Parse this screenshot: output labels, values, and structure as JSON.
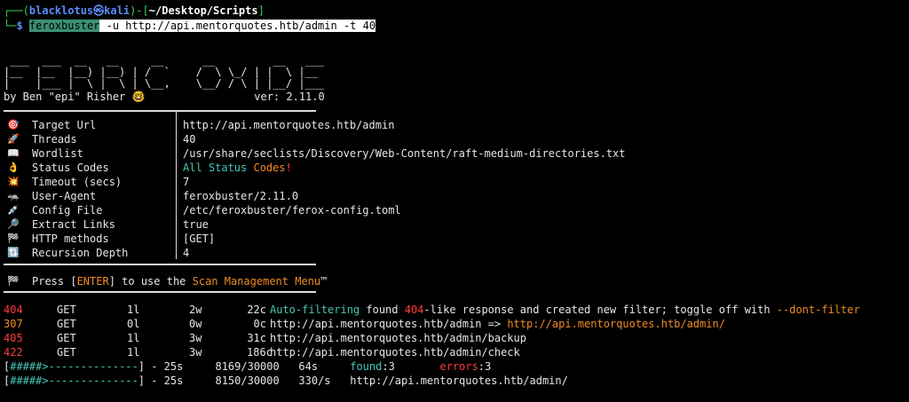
{
  "prompt": {
    "corner_top": "┌──(",
    "user": "blacklotus",
    "at": "㉿",
    "host": "kali",
    "close": ")-[",
    "path": "~/Desktop/Scripts",
    "close2": "]",
    "corner_bottom": "└─",
    "dollar": "$",
    "command_name": "feroxbuster",
    "command_args": " -u http://api.mentorquotes.htb/admin -t 40"
  },
  "banner": {
    "ascii": [
      " ___  ___  __   __     __      __         __   ___",
      "|__  |__  |__) |__) | /  `    /  \\ \\_/ | |  \\ |__",
      "|    |___ |  \\ |  \\ | \\__,    \\__/ / \\ | |__/ |___"
    ],
    "byline": "by Ben \"epi\" Risher 🤓                 ver: 2.11.0"
  },
  "config": [
    {
      "icon": "🎯",
      "icon_name": "target-icon",
      "label": "Target Url",
      "value": "http://api.mentorquotes.htb/admin"
    },
    {
      "icon": "🚀",
      "icon_name": "rocket-icon",
      "label": "Threads",
      "value": "40"
    },
    {
      "icon": "📖",
      "icon_name": "book-icon",
      "label": "Wordlist",
      "value": "/usr/share/seclists/Discovery/Web-Content/raft-medium-directories.txt"
    },
    {
      "icon": "👌",
      "icon_name": "ok-hand-icon",
      "label": "Status Codes",
      "value_a": "All Status ",
      "value_b": "Codes",
      "value_c": "!"
    },
    {
      "icon": "💥",
      "icon_name": "collision-icon",
      "label": "Timeout (secs)",
      "value": "7"
    },
    {
      "icon": "🦡",
      "icon_name": "badger-icon",
      "label": "User-Agent",
      "value": "feroxbuster/2.11.0"
    },
    {
      "icon": "💉",
      "icon_name": "syringe-icon",
      "label": "Config File",
      "value": "/etc/feroxbuster/ferox-config.toml"
    },
    {
      "icon": "🔎",
      "icon_name": "magnifier-icon",
      "label": "Extract Links",
      "value": "true"
    },
    {
      "icon": "🏁",
      "icon_name": "checkered-flag-icon",
      "label": "HTTP methods",
      "value": "[GET]"
    },
    {
      "icon": "🔃",
      "icon_name": "recursion-icon",
      "label": "Recursion Depth",
      "value": "4"
    }
  ],
  "press_enter": {
    "icon": "🏁",
    "text_a": "Press [",
    "enter": "ENTER",
    "text_b": "] to use the ",
    "menu": "Scan Management Menu",
    "tm": "™"
  },
  "results": [
    {
      "status": "404",
      "status_color": "#ff3b3b",
      "method": "GET",
      "lines": "1l",
      "words": "2w",
      "chars": "22c",
      "auto_a": "Auto-filtering",
      "auto_b": " found ",
      "auto_c": "404",
      "auto_d": "-like response and created new filter; toggle off with ",
      "auto_e": "--dont-filter"
    },
    {
      "status": "307",
      "status_color": "#f08a24",
      "method": "GET",
      "lines": "0l",
      "words": "0w",
      "chars": "0c",
      "url": "http://api.mentorquotes.htb/admin",
      "arrow": " => ",
      "redirect": "http://api.mentorquotes.htb/admin/"
    },
    {
      "status": "405",
      "status_color": "#ff3b3b",
      "method": "GET",
      "lines": "1l",
      "words": "3w",
      "chars": "31c",
      "url": "http://api.mentorquotes.htb/admin/backup"
    },
    {
      "status": "422",
      "status_color": "#ff3b3b",
      "method": "GET",
      "lines": "1l",
      "words": "3w",
      "chars": "186c",
      "url": "http://api.mentorquotes.htb/admin/check"
    }
  ],
  "progress": [
    {
      "bar_open": "[",
      "bar_fill": "#####>",
      "bar_empty": "--------------",
      "bar_close": "]",
      "elapsed": " - 25s",
      "count": "8169/30000",
      "rate": "64s",
      "found_label": "found",
      "found_val": ":3",
      "errors_label": "errors",
      "errors_val": ":3"
    },
    {
      "bar_open": "[",
      "bar_fill": "#####>",
      "bar_empty": "--------------",
      "bar_close": "]",
      "elapsed": " - 25s",
      "count": "8150/30000",
      "rate": "330/s",
      "url": "http://api.mentorquotes.htb/admin/"
    }
  ],
  "colors": {
    "prompt_blue": "#5b8dff",
    "status_red": "#ff3b3b",
    "status_orange": "#f08a24",
    "teal": "#47c6b8",
    "command_highlight": "#3c8f73"
  }
}
